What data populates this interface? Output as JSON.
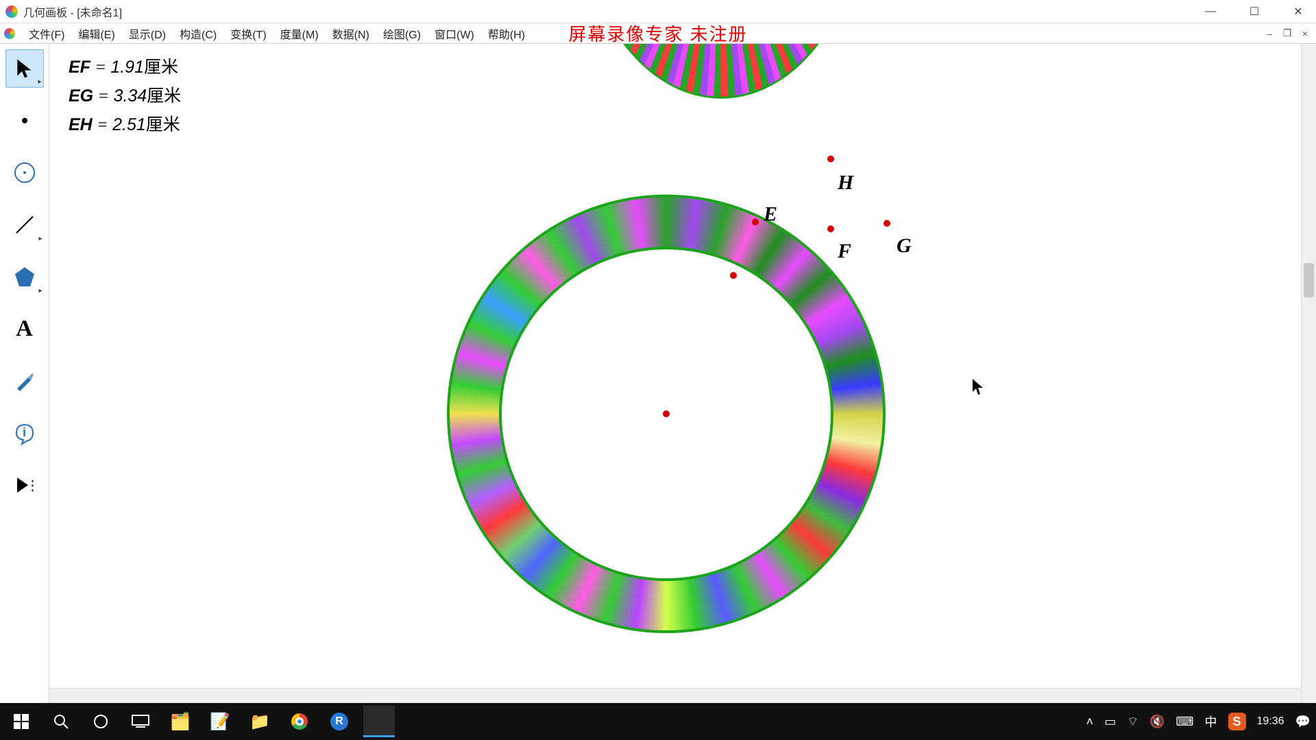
{
  "titlebar": {
    "title": "几何画板 - [未命名1]"
  },
  "menus": {
    "file": "文件(F)",
    "edit": "编辑(E)",
    "display": "显示(D)",
    "construct": "构造(C)",
    "transform": "变换(T)",
    "measure": "度量(M)",
    "data": "数据(N)",
    "graph": "绘图(G)",
    "window": "窗口(W)",
    "help": "帮助(H)"
  },
  "banner": "屏幕录像专家 未注册",
  "measurements": {
    "m1": {
      "label": "EF",
      "value": "1.91",
      "unit": "厘米"
    },
    "m2": {
      "label": "EG",
      "value": "3.34",
      "unit": "厘米"
    },
    "m3": {
      "label": "EH",
      "value": "2.51",
      "unit": "厘米"
    }
  },
  "points": {
    "E": {
      "label": "E"
    },
    "F": {
      "label": "F"
    },
    "G": {
      "label": "G"
    },
    "H": {
      "label": "H"
    }
  },
  "tools": {
    "arrow": "选择箭头",
    "point": "点",
    "compass": "圆",
    "line": "线段",
    "polygon": "多边形",
    "text": "A",
    "marker": "标记",
    "info": "信息",
    "custom": "自定义"
  },
  "taskbar": {
    "ime": "中",
    "clock": "19:36"
  }
}
